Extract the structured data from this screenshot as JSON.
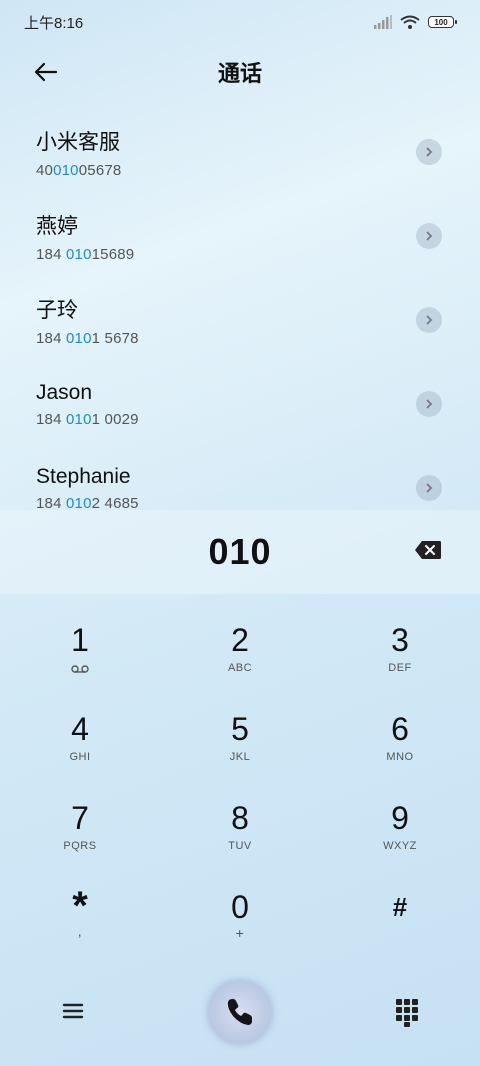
{
  "status": {
    "time": "上午8:16",
    "battery": "100"
  },
  "header": {
    "title": "通话"
  },
  "contacts": [
    {
      "name": "小米客服",
      "num_pre": "40",
      "num_hl": "010",
      "num_post": "05678"
    },
    {
      "name": "燕婷",
      "num_pre": "184 ",
      "num_hl": "010",
      "num_post": "15689"
    },
    {
      "name": "子玲",
      "num_pre": "184 ",
      "num_hl": "010",
      "num_post": "1 5678"
    },
    {
      "name": "Jason",
      "num_pre": "184 ",
      "num_hl": "010",
      "num_post": "1 0029"
    },
    {
      "name": "Stephanie",
      "num_pre": "184 ",
      "num_hl": "010",
      "num_post": "2 4685"
    }
  ],
  "dialer": {
    "number": "010"
  },
  "keys": [
    {
      "digit": "1",
      "sub": ""
    },
    {
      "digit": "2",
      "sub": "ABC"
    },
    {
      "digit": "3",
      "sub": "DEF"
    },
    {
      "digit": "4",
      "sub": "GHI"
    },
    {
      "digit": "5",
      "sub": "JKL"
    },
    {
      "digit": "6",
      "sub": "MNO"
    },
    {
      "digit": "7",
      "sub": "PQRS"
    },
    {
      "digit": "8",
      "sub": "TUV"
    },
    {
      "digit": "9",
      "sub": "WXYZ"
    },
    {
      "digit": "*",
      "sub": ","
    },
    {
      "digit": "0",
      "sub": "+"
    },
    {
      "digit": "#",
      "sub": ""
    }
  ],
  "icons": {
    "back": "arrow-left-icon",
    "chevron": "chevron-right-icon",
    "backspace": "backspace-icon",
    "voicemail": "voicemail-icon",
    "menu": "menu-icon",
    "call": "phone-icon",
    "dialpad": "dialpad-icon"
  },
  "colors": {
    "highlight": "#1a8ccf",
    "call_button": "#b9c7e2"
  }
}
